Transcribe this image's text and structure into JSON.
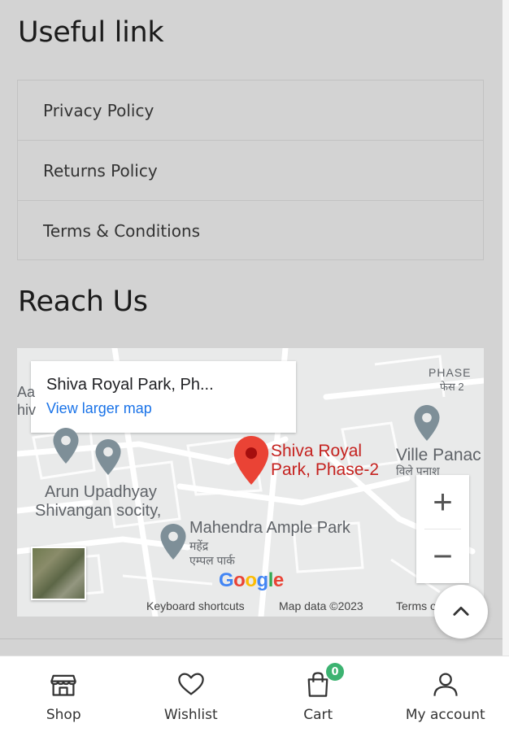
{
  "useful_links": {
    "heading": "Useful link",
    "items": [
      {
        "label": "Privacy Policy"
      },
      {
        "label": "Returns Policy"
      },
      {
        "label": "Terms & Conditions"
      }
    ]
  },
  "reach_us": {
    "heading": "Reach Us"
  },
  "map": {
    "place_title": "Shiva Royal Park, Ph...",
    "view_larger": "View larger map",
    "pin_label_line1": "Shiva Royal",
    "pin_label_line2": "Park, Phase-2",
    "labels": {
      "phase": "PHASE",
      "phase_hi": "फेस 2",
      "ville": "Ville Panac",
      "ville_hi": "विले पनाश",
      "arun1": "Arun Upadhyay",
      "arun2": "Shivangan socity,",
      "mahendra": "Mahendra Ample Park",
      "mahendra_hi1": "महेंद्र",
      "mahendra_hi2": "एम्पल पार्क",
      "edge1": "Aa",
      "edge2": "hiv"
    },
    "zoom_in": "+",
    "zoom_out": "−",
    "logo": "Google",
    "keyboard_shortcuts": "Keyboard shortcuts",
    "map_data": "Map data ©2023",
    "terms": "Terms of Use",
    "pin_color": "#ea4335"
  },
  "bottom_nav": {
    "items": [
      {
        "label": "Shop",
        "icon": "shop-icon"
      },
      {
        "label": "Wishlist",
        "icon": "heart-icon"
      },
      {
        "label": "Cart",
        "icon": "cart-icon",
        "badge": "0"
      },
      {
        "label": "My account",
        "icon": "user-icon"
      }
    ],
    "badge_color": "#3cb371"
  }
}
